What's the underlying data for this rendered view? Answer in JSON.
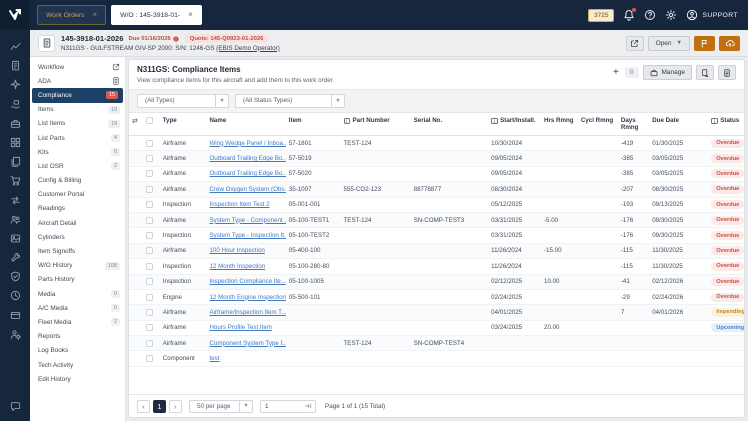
{
  "navbar": {
    "tabs": [
      {
        "label": "Work Orders"
      },
      {
        "label": "W/O : 145-3918-01-"
      }
    ],
    "counter": "3725",
    "support": "SUPPORT"
  },
  "wo_header": {
    "number": "145-3918-01-2026",
    "due": "Due 01/16/2026",
    "quote": "Quote: 145-Q0923-01-2026",
    "aircraft": "N311GS - GULFSTREAM GIV-SP 2000: S/N: 1246-GS",
    "operator": "(EBIS Demo Operator)",
    "open_label": "Open"
  },
  "rail": {
    "icons": [
      "line-chart-icon",
      "work-order-icon",
      "airplane-icon",
      "parts-hand-icon",
      "toolbox-icon",
      "org-grid-icon",
      "copy-pages-icon",
      "cart-icon",
      "transfer-arrows-icon",
      "people-icon",
      "media-image-icon",
      "tools-icon",
      "shield-check-icon",
      "clock-icon",
      "card-icon",
      "person-settings-icon"
    ],
    "bottom_icon": "chat-icon"
  },
  "sidebar": {
    "items": [
      {
        "label": "Workflow",
        "trail_icon": "external-link-icon"
      },
      {
        "label": "ADA",
        "trail_icon": "document-icon"
      },
      {
        "label": "Compliance",
        "badge": "15",
        "badge_style": "red",
        "active": true
      },
      {
        "label": "Items",
        "badge": "19"
      },
      {
        "label": "List Items",
        "badge": "19"
      },
      {
        "label": "List Parts",
        "badge": "4"
      },
      {
        "label": "Kits",
        "badge": "0"
      },
      {
        "label": "List OSR",
        "badge": "2"
      },
      {
        "label": "Config & Billing"
      },
      {
        "label": "Customer Portal"
      },
      {
        "label": "Readings"
      },
      {
        "label": "Aircraft Detail"
      },
      {
        "label": "Cylinders"
      },
      {
        "label": "Item Signoffs"
      },
      {
        "label": "W/O History",
        "badge": "108"
      },
      {
        "label": "Parts History"
      },
      {
        "label": "Media",
        "badge": "0"
      },
      {
        "label": "A/C Media",
        "badge": "0"
      },
      {
        "label": "Fleet Media",
        "badge": "2"
      },
      {
        "label": "Reports"
      },
      {
        "label": "Log Books"
      },
      {
        "label": "Tech Activity"
      },
      {
        "label": "Edit History"
      }
    ]
  },
  "panel": {
    "title": "N311GS: Compliance Items",
    "subtitle": "View compliance items for this aircraft and add them to this work order",
    "selected_count": "0",
    "manage_label": "Manage",
    "filters": {
      "type": "(All Types)",
      "status": "(All Status Types)"
    }
  },
  "table": {
    "columns": [
      {
        "key": "type",
        "label": "Type"
      },
      {
        "key": "name",
        "label": "Name"
      },
      {
        "key": "item",
        "label": "Item"
      },
      {
        "key": "part",
        "label": "Part Number",
        "info": true
      },
      {
        "key": "serial",
        "label": "Serial No."
      },
      {
        "key": "start",
        "label": "Start/Install.",
        "info": true
      },
      {
        "key": "hrs",
        "label": "Hrs Rmng"
      },
      {
        "key": "cycl",
        "label": "Cycl Rmng"
      },
      {
        "key": "days",
        "label": "Days Rmng"
      },
      {
        "key": "due",
        "label": "Due Date"
      },
      {
        "key": "status",
        "label": "Status",
        "info": true
      }
    ],
    "rows": [
      {
        "type": "Airframe",
        "name": "Wing Wedge Panel / Inboa...",
        "item": "57-1801",
        "part": "TEST-124",
        "serial": "",
        "start": "10/30/2024",
        "hrs": "",
        "cycl": "",
        "days": "-419",
        "due": "01/30/2025",
        "status": "Overdue"
      },
      {
        "type": "Airframe",
        "name": "Outboard Trailing Edge Bo...",
        "item": "57-5019",
        "part": "",
        "serial": "",
        "start": "09/05/2024",
        "hrs": "",
        "cycl": "",
        "days": "-385",
        "due": "03/05/2025",
        "status": "Overdue"
      },
      {
        "type": "Airframe",
        "name": "Outboard Trailing Edge Bo...",
        "item": "57-5020",
        "part": "",
        "serial": "",
        "start": "09/05/2024",
        "hrs": "",
        "cycl": "",
        "days": "-385",
        "due": "03/05/2025",
        "status": "Overdue"
      },
      {
        "type": "Airframe",
        "name": "Crew Oxygen System (Obs...",
        "item": "35-1007",
        "part": "555-CO2-123",
        "serial": "88778877",
        "start": "08/30/2024",
        "hrs": "",
        "cycl": "",
        "days": "-207",
        "due": "08/30/2025",
        "status": "Overdue"
      },
      {
        "type": "Inspection",
        "name": "Inspection Item Test 2",
        "item": "05-001-001",
        "part": "",
        "serial": "",
        "start": "05/12/2025",
        "hrs": "",
        "cycl": "",
        "days": "-193",
        "due": "09/13/2025",
        "status": "Overdue"
      },
      {
        "type": "Airframe",
        "name": "System Type - Component ...",
        "item": "05-100-TEST1",
        "part": "TEST-124",
        "serial": "SN-COMP-TEST3",
        "start": "03/31/2025",
        "hrs": "-5.00",
        "cycl": "",
        "days": "-176",
        "due": "09/30/2025",
        "status": "Overdue"
      },
      {
        "type": "Inspection",
        "name": "System Type - Inspection It...",
        "item": "05-100-TEST2",
        "part": "",
        "serial": "",
        "start": "03/31/2025",
        "hrs": "",
        "cycl": "",
        "days": "-176",
        "due": "09/30/2025",
        "status": "Overdue"
      },
      {
        "type": "Airframe",
        "name": "100 Hour Inspection",
        "item": "05-400-100",
        "part": "",
        "serial": "",
        "start": "11/26/2024",
        "hrs": "-15.00",
        "cycl": "",
        "days": "-115",
        "due": "11/30/2025",
        "status": "Overdue"
      },
      {
        "type": "Inspection",
        "name": "12 Month Inspection",
        "item": "05-100-280-80",
        "part": "",
        "serial": "",
        "start": "11/26/2024",
        "hrs": "",
        "cycl": "",
        "days": "-115",
        "due": "11/30/2025",
        "status": "Overdue"
      },
      {
        "type": "Inspection",
        "name": "Inspection Compliance Ite...",
        "item": "05-100-1005",
        "part": "",
        "serial": "",
        "start": "02/12/2025",
        "hrs": "10.00",
        "cycl": "",
        "days": "-41",
        "due": "02/12/2026",
        "status": "Overdue"
      },
      {
        "type": "Engine",
        "name": "12 Month Engine Inspection",
        "item": "05-500-101",
        "part": "",
        "serial": "",
        "start": "02/24/2025",
        "hrs": "",
        "cycl": "",
        "days": "-29",
        "due": "02/24/2026",
        "status": "Overdue"
      },
      {
        "type": "Airframe",
        "name": "Airframe/Inspection Item T...",
        "item": "",
        "part": "",
        "serial": "",
        "start": "04/01/2025",
        "hrs": "",
        "cycl": "",
        "days": "7",
        "due": "04/01/2026",
        "status": "Impending"
      },
      {
        "type": "Airframe",
        "name": "Hours Profile Test Item",
        "item": "",
        "part": "",
        "serial": "",
        "start": "03/24/2025",
        "hrs": "20.00",
        "cycl": "",
        "days": "",
        "due": "",
        "status": "Upcoming"
      },
      {
        "type": "Airframe",
        "name": "Component System Type f...",
        "item": "",
        "part": "TEST-124",
        "serial": "SN-COMP-TEST4",
        "start": "",
        "hrs": "",
        "cycl": "",
        "days": "",
        "due": "",
        "status": ""
      },
      {
        "type": "Component",
        "name": "test",
        "item": "",
        "part": "",
        "serial": "",
        "start": "",
        "hrs": "",
        "cycl": "",
        "days": "",
        "due": "",
        "status": ""
      }
    ]
  },
  "pagination": {
    "page": "1",
    "per_page": "50 per page",
    "goto_value": "1",
    "summary": "Page 1 of 1 (15 Total)"
  },
  "colors": {
    "navy": "#16263c",
    "active_item": "#1d4166",
    "accent_amber": "#bf7112",
    "alert_red": "#c8473f",
    "link_blue": "#4179c4"
  }
}
